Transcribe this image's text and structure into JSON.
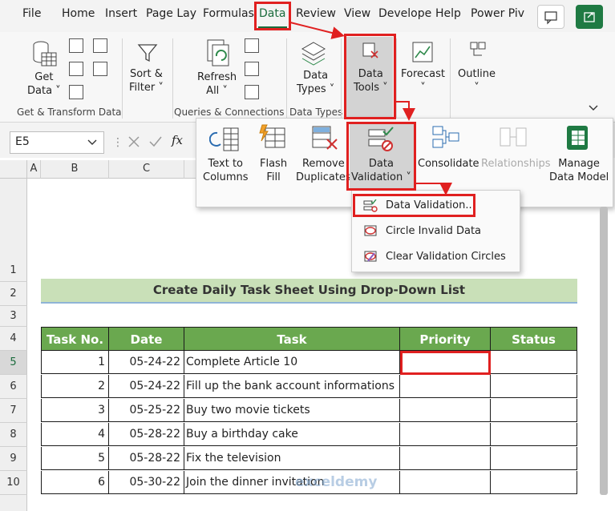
{
  "tabs": [
    "File",
    "Home",
    "Insert",
    "Page Lay",
    "Formulas",
    "Data",
    "Review",
    "View",
    "Develope",
    "Help",
    "Power Piv"
  ],
  "ribbon": {
    "get_data": "Get\nData ˅",
    "sort_filter": "Sort &\nFilter ˅",
    "refresh_all": "Refresh\nAll ˅",
    "data_types": "Data\nTypes ˅",
    "data_tools": "Data\nTools ˅",
    "forecast": "Forecast\n˅",
    "outline": "Outline\n˅",
    "groups": {
      "get_transform": "Get & Transform Data",
      "queries": "Queries & Connections",
      "data_types": "Data Types"
    }
  },
  "formula_bar": {
    "name_box": "E5",
    "fx": "fx"
  },
  "columns": [
    "A",
    "B",
    "C"
  ],
  "rows": [
    "1",
    "2",
    "3",
    "4",
    "5",
    "6",
    "7",
    "8",
    "9",
    "10"
  ],
  "data_tools_panel": {
    "text_to_columns": "Text to\nColumns",
    "flash_fill": "Flash\nFill",
    "remove_duplicates": "Remove\nDuplicates",
    "data_validation": "Data\nValidation ˅",
    "consolidate": "Consolidate",
    "relationships": "Relationships",
    "manage_data_model": "Manage\nData Model"
  },
  "dv_menu": [
    "Data Validation...",
    "Circle Invalid Data",
    "Clear Validation Circles"
  ],
  "sheet": {
    "title": "Create Daily Task Sheet Using Drop-Down List",
    "headers": [
      "Task No.",
      "Date",
      "Task",
      "Priority",
      "Status"
    ],
    "rows": [
      [
        "1",
        "05-24-22",
        "Complete Article 10"
      ],
      [
        "2",
        "05-24-22",
        "Fill up the bank account informations"
      ],
      [
        "3",
        "05-25-22",
        "Buy two movie tickets"
      ],
      [
        "4",
        "05-28-22",
        "Buy a birthday cake"
      ],
      [
        "5",
        "05-28-22",
        "Fix the television"
      ],
      [
        "6",
        "05-30-22",
        "Join the dinner invitation"
      ]
    ]
  },
  "watermark": "exceldemy",
  "colors": {
    "accent": "#1a6b3c",
    "header_green": "#6aa84f",
    "title_band": "#c9e0b8",
    "highlight": "#e02020"
  }
}
